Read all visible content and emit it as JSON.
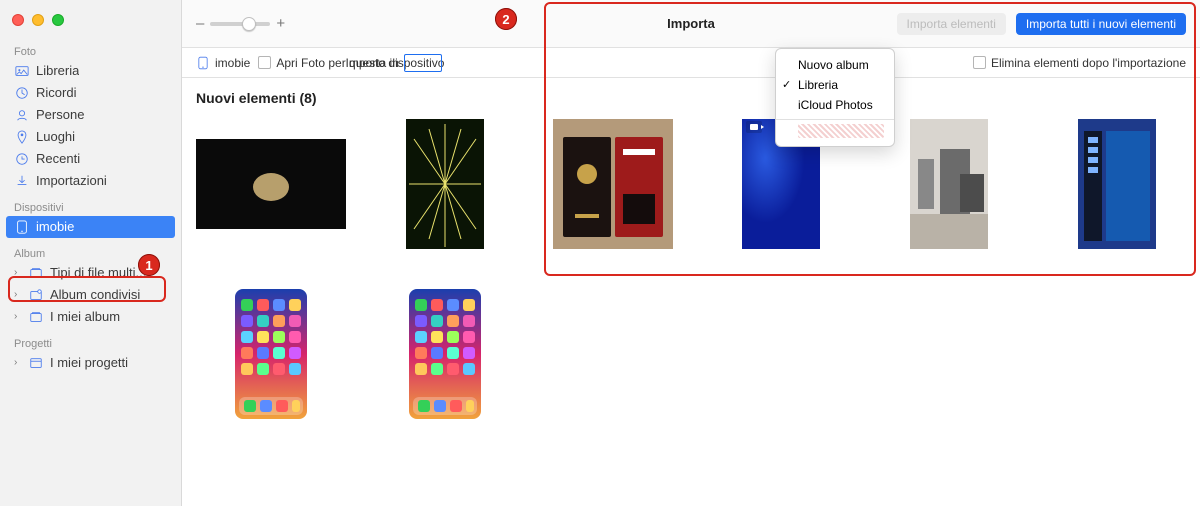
{
  "window": {
    "title": "Importa"
  },
  "toolbar": {
    "zoom": {
      "minus": "–",
      "plus": "+"
    },
    "import_selected_label": "Importa elementi",
    "import_all_label": "Importa tutti i nuovi elementi"
  },
  "subbar": {
    "device_name": "imobie",
    "open_photos_label": "Apri Foto per questo dispositivo",
    "import_to_label": "Importa in",
    "delete_after_label": "Elimina elementi dopo l'importazione"
  },
  "popover": {
    "items": [
      {
        "label": "Nuovo album",
        "checked": false
      },
      {
        "label": "Libreria",
        "checked": true
      },
      {
        "label": "iCloud Photos",
        "checked": false
      }
    ]
  },
  "sidebar": {
    "sections": [
      {
        "header": "Foto",
        "items": [
          {
            "label": "Libreria",
            "icon": "photos"
          },
          {
            "label": "Ricordi",
            "icon": "memories"
          },
          {
            "label": "Persone",
            "icon": "people"
          },
          {
            "label": "Luoghi",
            "icon": "places"
          },
          {
            "label": "Recenti",
            "icon": "recent"
          },
          {
            "label": "Importazioni",
            "icon": "imports"
          }
        ]
      },
      {
        "header": "Dispositivi",
        "items": [
          {
            "label": "imobie",
            "icon": "device",
            "selected": true
          }
        ]
      },
      {
        "header": "Album",
        "items": [
          {
            "label": "Tipi di file multi...",
            "icon": "album",
            "chevron": true
          },
          {
            "label": "Album condivisi",
            "icon": "shared",
            "chevron": true
          },
          {
            "label": "I miei album",
            "icon": "album",
            "chevron": true
          }
        ]
      },
      {
        "header": "Progetti",
        "items": [
          {
            "label": "I miei progetti",
            "icon": "project",
            "chevron": true
          }
        ]
      }
    ]
  },
  "content": {
    "section_title": "Nuovi elementi (8)",
    "thumbs": [
      {
        "kind": "moon"
      },
      {
        "kind": "fireworks"
      },
      {
        "kind": "books"
      },
      {
        "kind": "bluevideo"
      },
      {
        "kind": "room"
      },
      {
        "kind": "desktop"
      },
      {
        "kind": "iphone"
      },
      {
        "kind": "iphone"
      }
    ]
  },
  "annotations": {
    "callout1": "1",
    "callout2": "2"
  }
}
